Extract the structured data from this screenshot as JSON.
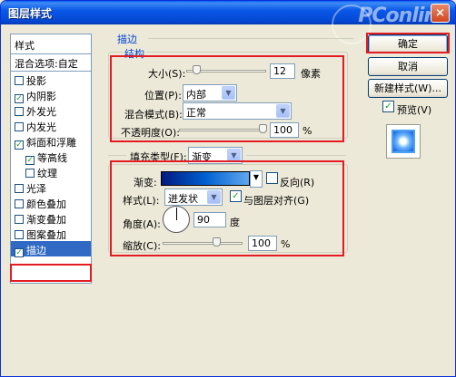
{
  "window": {
    "title": "图层样式",
    "close": "×"
  },
  "watermark": {
    "logo": "PConline",
    "sub": "太平洋电脑网"
  },
  "style_list": {
    "header": "样式",
    "blend_options": "混合选项:自定",
    "items": [
      {
        "label": "投影",
        "checked": false
      },
      {
        "label": "内阴影",
        "checked": true
      },
      {
        "label": "外发光",
        "checked": false
      },
      {
        "label": "内发光",
        "checked": false
      },
      {
        "label": "斜面和浮雕",
        "checked": true
      },
      {
        "label": "等高线",
        "checked": true
      },
      {
        "label": "纹理",
        "checked": false
      },
      {
        "label": "光泽",
        "checked": false
      },
      {
        "label": "颜色叠加",
        "checked": false
      },
      {
        "label": "渐变叠加",
        "checked": false
      },
      {
        "label": "图案叠加",
        "checked": false
      },
      {
        "label": "描边",
        "checked": true
      }
    ]
  },
  "panel": {
    "title": "描边",
    "structure": {
      "legend": "结构",
      "size_label": "大小(S):",
      "size_value": "12",
      "size_unit": "像素",
      "size_level": 0.12,
      "position_label": "位置(P):",
      "position_value": "内部",
      "blend_label": "混合模式(B):",
      "blend_value": "正常",
      "opacity_label": "不透明度(O):",
      "opacity_value": "100",
      "opacity_unit": "%",
      "opacity_level": 1.0
    },
    "fill": {
      "type_label": "填充类型(F):",
      "type_value": "渐变",
      "gradient_label": "渐变:",
      "reverse_label": "反向(R)",
      "reverse_checked": false,
      "style_label": "样式(L):",
      "style_value": "迸发状",
      "align_label": "与图层对齐(G)",
      "align_checked": true,
      "angle_label": "角度(A):",
      "angle_value": "90",
      "angle_unit": "度",
      "scale_label": "缩放(C):",
      "scale_value": "100",
      "scale_unit": "%",
      "scale_level": 0.67
    }
  },
  "buttons": {
    "ok": "确定",
    "cancel": "取消",
    "new_style": "新建样式(W)...",
    "preview_label": "预览(V)",
    "preview_checked": true
  },
  "colors": {
    "accent": "#0046d5",
    "highlight": "#e31b23",
    "selected": "#316ac5"
  }
}
